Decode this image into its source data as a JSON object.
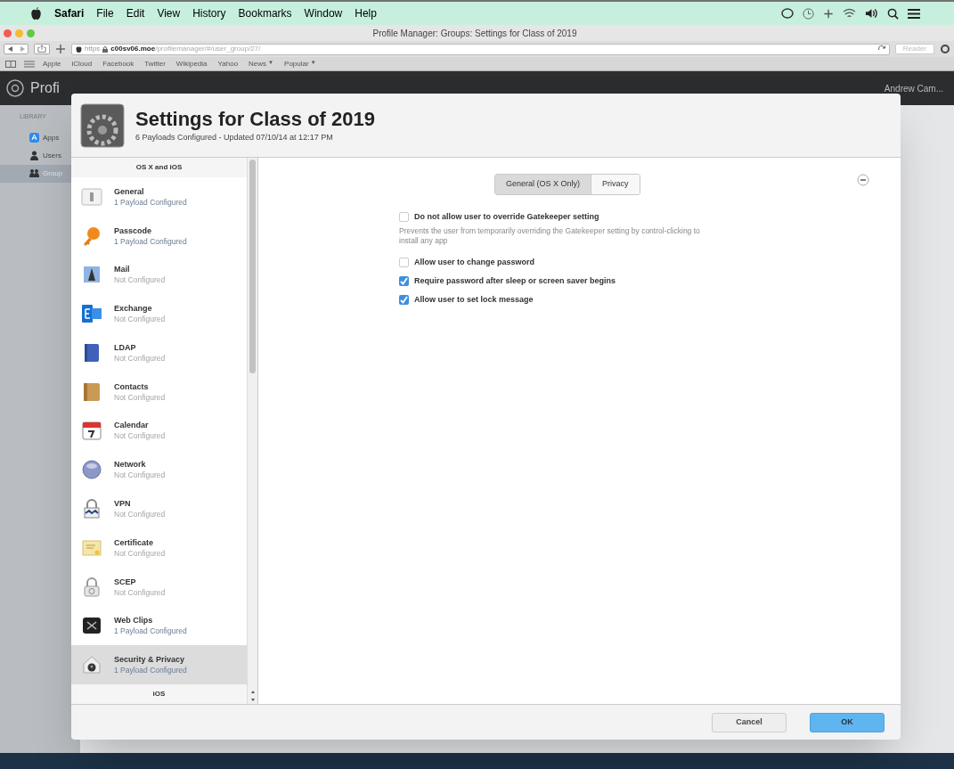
{
  "menubar": {
    "app": "Safari",
    "items": [
      "File",
      "Edit",
      "View",
      "History",
      "Bookmarks",
      "Window",
      "Help"
    ]
  },
  "window": {
    "title": "Profile Manager: Groups: Settings for Class of 2019"
  },
  "address": {
    "scheme": "https",
    "host": "c00sv06.moe",
    "path": "/profilemanager/#/user_group/27/",
    "reader": "Reader"
  },
  "bookmarks": [
    {
      "label": "Apple"
    },
    {
      "label": "iCloud"
    },
    {
      "label": "Facebook"
    },
    {
      "label": "Twitter"
    },
    {
      "label": "Wikipedia"
    },
    {
      "label": "Yahoo"
    },
    {
      "label": "News",
      "caret": "▼"
    },
    {
      "label": "Popular",
      "caret": "▼"
    }
  ],
  "app_header": {
    "title": "Profi",
    "user": "Andrew Cam..."
  },
  "library": {
    "heading": "LIBRARY",
    "items": [
      {
        "label": "Apps",
        "selected": false
      },
      {
        "label": "Users",
        "selected": false
      },
      {
        "label": "Group",
        "selected": true
      }
    ]
  },
  "dialog": {
    "title": "Settings for Class of 2019",
    "subtitle": "6 Payloads Configured - Updated 07/10/14 at 12:17 PM",
    "section": "OS X and iOS",
    "payloads": [
      {
        "name": "General",
        "status": "1 Payload Configured",
        "configured": true,
        "selected": false
      },
      {
        "name": "Passcode",
        "status": "1 Payload Configured",
        "configured": true,
        "selected": false
      },
      {
        "name": "Mail",
        "status": "Not Configured",
        "configured": false,
        "selected": false
      },
      {
        "name": "Exchange",
        "status": "Not Configured",
        "configured": false,
        "selected": false
      },
      {
        "name": "LDAP",
        "status": "Not Configured",
        "configured": false,
        "selected": false
      },
      {
        "name": "Contacts",
        "status": "Not Configured",
        "configured": false,
        "selected": false
      },
      {
        "name": "Calendar",
        "status": "Not Configured",
        "configured": false,
        "selected": false
      },
      {
        "name": "Network",
        "status": "Not Configured",
        "configured": false,
        "selected": false
      },
      {
        "name": "VPN",
        "status": "Not Configured",
        "configured": false,
        "selected": false
      },
      {
        "name": "Certificate",
        "status": "Not Configured",
        "configured": false,
        "selected": false
      },
      {
        "name": "SCEP",
        "status": "Not Configured",
        "configured": false,
        "selected": false
      },
      {
        "name": "Web Clips",
        "status": "1 Payload Configured",
        "configured": true,
        "selected": false
      },
      {
        "name": "Security & Privacy",
        "status": "1 Payload Configured",
        "configured": true,
        "selected": true
      }
    ],
    "next_section": "iOS",
    "tabs": [
      {
        "label": "General (OS X Only)",
        "selected": true
      },
      {
        "label": "Privacy",
        "selected": false
      }
    ],
    "options": [
      {
        "label": "Do not allow user to override Gatekeeper setting",
        "checked": false,
        "description": "Prevents the user from temporarily overriding the Gatekeeper setting by control-clicking to install any app"
      },
      {
        "label": "Allow user to change password",
        "checked": false
      },
      {
        "label": "Require password after sleep or screen saver begins",
        "checked": true
      },
      {
        "label": "Allow user to set lock message",
        "checked": true
      }
    ],
    "buttons": [
      {
        "label": "Cancel",
        "kind": "secondary"
      },
      {
        "label": "OK",
        "kind": "primary"
      }
    ]
  }
}
